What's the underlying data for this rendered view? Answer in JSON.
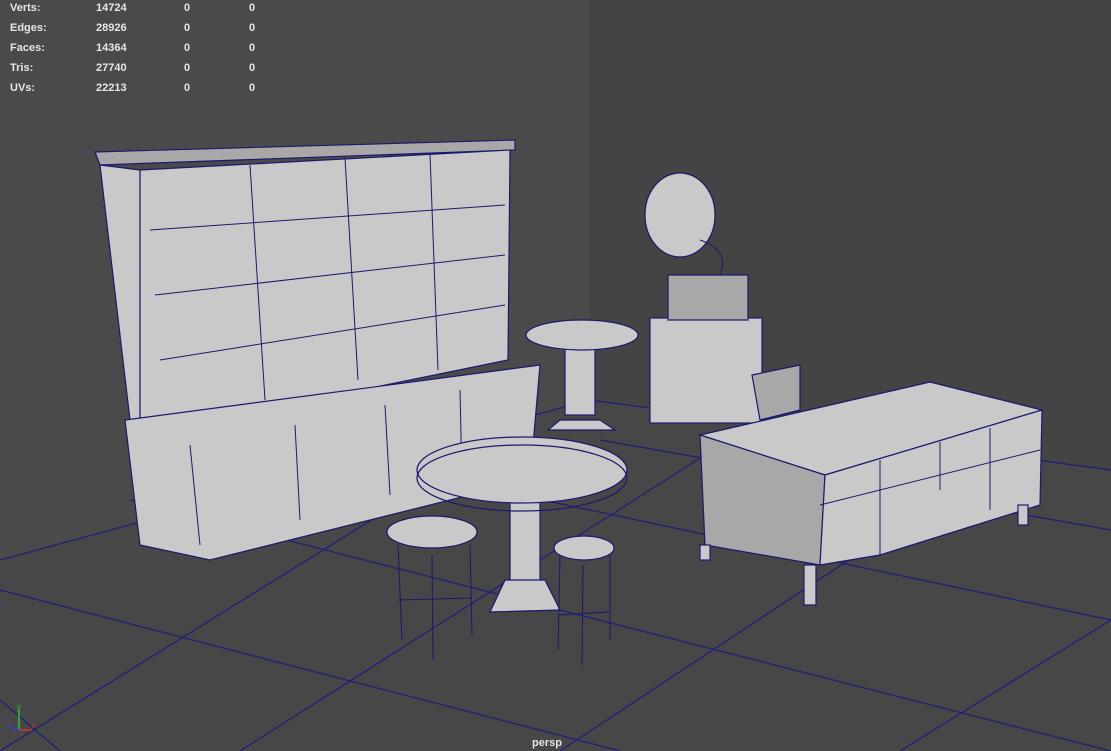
{
  "stats": [
    {
      "label": "Verts:",
      "value": "14724",
      "selected": "0",
      "uv": "0"
    },
    {
      "label": "Edges:",
      "value": "28926",
      "selected": "0",
      "uv": "0"
    },
    {
      "label": "Faces:",
      "value": "14364",
      "selected": "0",
      "uv": "0"
    },
    {
      "label": "Tris:",
      "value": "27740",
      "selected": "0",
      "uv": "0"
    },
    {
      "label": "UVs:",
      "value": "22213",
      "selected": "0",
      "uv": "0"
    }
  ],
  "camera": "persp",
  "axis": {
    "x": "x",
    "y": "y",
    "z": "z"
  },
  "colors": {
    "background": "#474747",
    "wireframe": "#1a1a6e",
    "mesh": "#c9c9c9",
    "x_axis": "#d03030",
    "y_axis": "#30c030",
    "z_axis": "#3040e0"
  }
}
